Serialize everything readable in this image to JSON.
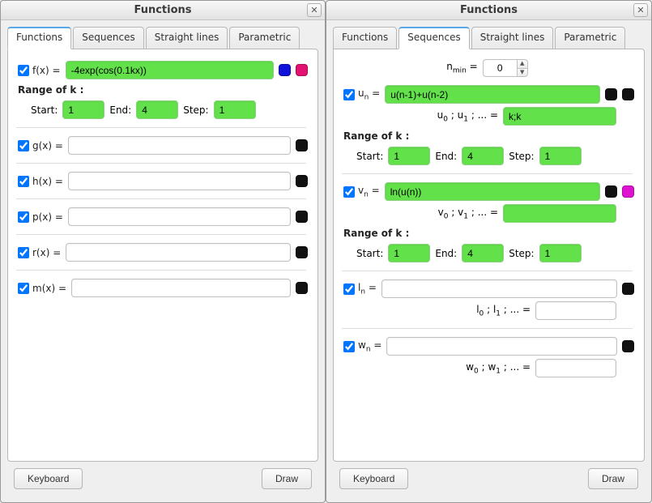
{
  "left": {
    "title": "Functions",
    "tabs": [
      "Functions",
      "Sequences",
      "Straight lines",
      "Parametric"
    ],
    "active_tab": 0,
    "entries": {
      "f": {
        "label": "f(x) =",
        "value": "-4exp(cos(0.1kx))"
      },
      "g": {
        "label": "g(x) =",
        "value": ""
      },
      "h": {
        "label": "h(x) =",
        "value": ""
      },
      "p": {
        "label": "p(x) =",
        "value": ""
      },
      "r": {
        "label": "r(x) =",
        "value": ""
      },
      "m": {
        "label": "m(x) =",
        "value": ""
      }
    },
    "range_label": "Range of k :",
    "range": {
      "start_label": "Start:",
      "start": "1",
      "end_label": "End:",
      "end": "4",
      "step_label": "Step:",
      "step": "1"
    },
    "footer": {
      "keyboard": "Keyboard",
      "draw": "Draw"
    }
  },
  "right": {
    "title": "Functions",
    "tabs": [
      "Functions",
      "Sequences",
      "Straight lines",
      "Parametric"
    ],
    "active_tab": 1,
    "nmin": {
      "label": "nₘᵢₙ =",
      "value": "0"
    },
    "seq_u": {
      "label": "uₙ =",
      "value": "u(n-1)+u(n-2)",
      "init_label": "u₀ ; u₁ ; ... =",
      "init": "k;k"
    },
    "seq_v": {
      "label": "vₙ =",
      "value": "ln(u(n))",
      "init_label": "v₀ ; v₁ ; ... =",
      "init": ""
    },
    "seq_l": {
      "label": "lₙ =",
      "value": "",
      "init_label": "l₀ ; l₁ ; ... =",
      "init": ""
    },
    "seq_w": {
      "label": "wₙ =",
      "value": "",
      "init_label": "w₀ ; w₁ ; ... =",
      "init": ""
    },
    "range_label": "Range of k :",
    "range_u": {
      "start_label": "Start:",
      "start": "1",
      "end_label": "End:",
      "end": "4",
      "step_label": "Step:",
      "step": "1"
    },
    "range_v": {
      "start_label": "Start:",
      "start": "1",
      "end_label": "End:",
      "end": "4",
      "step_label": "Step:",
      "step": "1"
    },
    "footer": {
      "keyboard": "Keyboard",
      "draw": "Draw"
    }
  }
}
